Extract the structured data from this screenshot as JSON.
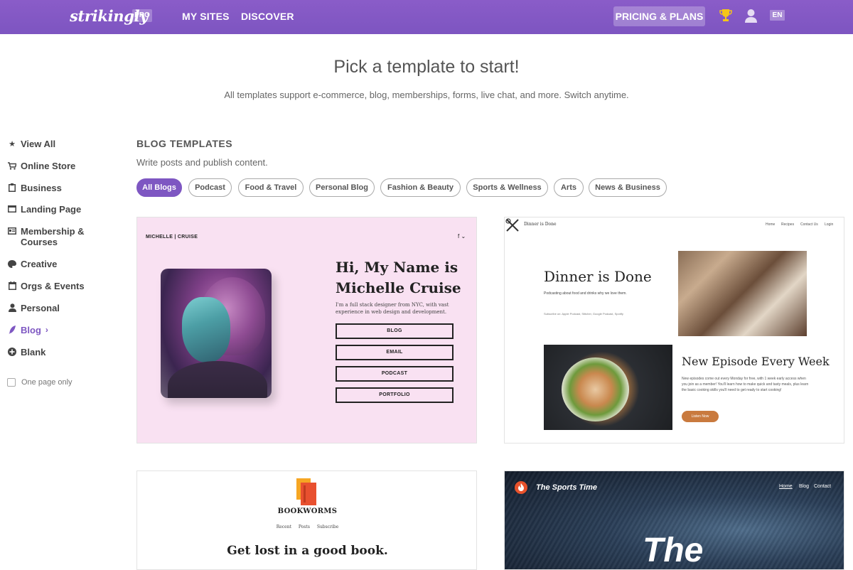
{
  "nav": {
    "logo": "strikingly",
    "pro_badge": "PRO",
    "links": [
      "MY SITES",
      "DISCOVER"
    ],
    "pricing": "PRICING & PLANS",
    "lang": "EN",
    "icons": [
      "trophy-icon",
      "user-icon"
    ],
    "bg_color": "#7e57c2"
  },
  "hero": {
    "title": "Pick a template to start!",
    "subtitle": "All templates support e-commerce, blog, memberships, forms, live chat, and more. Switch anytime."
  },
  "sidebar": {
    "items": [
      {
        "label": "View All",
        "icon": "star-icon"
      },
      {
        "label": "Online Store",
        "icon": "cart-icon"
      },
      {
        "label": "Business",
        "icon": "clipboard-icon"
      },
      {
        "label": "Landing Page",
        "icon": "window-icon"
      },
      {
        "label": "Membership &",
        "label2": "Courses",
        "icon": "id-card-icon"
      },
      {
        "label": "Creative",
        "icon": "palette-icon"
      },
      {
        "label": "Orgs & Events",
        "icon": "calendar-icon"
      },
      {
        "label": "Personal",
        "icon": "person-icon"
      },
      {
        "label": "Blog",
        "icon": "quill-icon",
        "active": true
      },
      {
        "label": "Blank",
        "icon": "plus-circle-icon"
      }
    ],
    "one_page_only": "One page only"
  },
  "main": {
    "section_title": "BLOG TEMPLATES",
    "section_subtitle": "Write posts and publish content.",
    "filters": [
      "All Blogs",
      "Podcast",
      "Food & Travel",
      "Personal Blog",
      "Fashion & Beauty",
      "Sports & Wellness",
      "Arts",
      "News & Business"
    ],
    "active_filter": "All Blogs",
    "accent": "#7e57c2"
  },
  "templates": {
    "michelle": {
      "brand": "MICHELLE | CRUISE",
      "social": "f ⌄",
      "headline": "Hi, My Name is Michelle Cruise",
      "bio": "I'm a full stack designer from NYC, with vast experience in web design and development.",
      "buttons": [
        "BLOG",
        "EMAIL",
        "PODCAST",
        "PORTFOLIO"
      ]
    },
    "dinner": {
      "site_name": "Dinner is Done",
      "menu": [
        "Home",
        "Recipes",
        "Contact Us",
        "Login"
      ],
      "headline": "Dinner is Done",
      "para": "Podcasting about food and drinks why we love them.",
      "subscribe": "Subscribe on: Apple Podcast, Stitcher, Google Podcast, Spotify",
      "headline2": "New Episode Every Week",
      "para2": "New episodes come out every Monday for free, with 1 week early access when you join as a member! You'll learn how to make quick and tasty meals, plus learn the basic cooking skills you'll need to get ready to start cooking!",
      "listen": "Listen Now"
    },
    "bookworms": {
      "title": "BOOKWORMS",
      "nav": [
        "Recent",
        "Posts",
        "Subscribe"
      ],
      "headline": "Get lost in a good book."
    },
    "sports": {
      "title": "The Sports Time",
      "nav": [
        "Home",
        "Blog",
        "Contact"
      ],
      "big": "The"
    }
  }
}
